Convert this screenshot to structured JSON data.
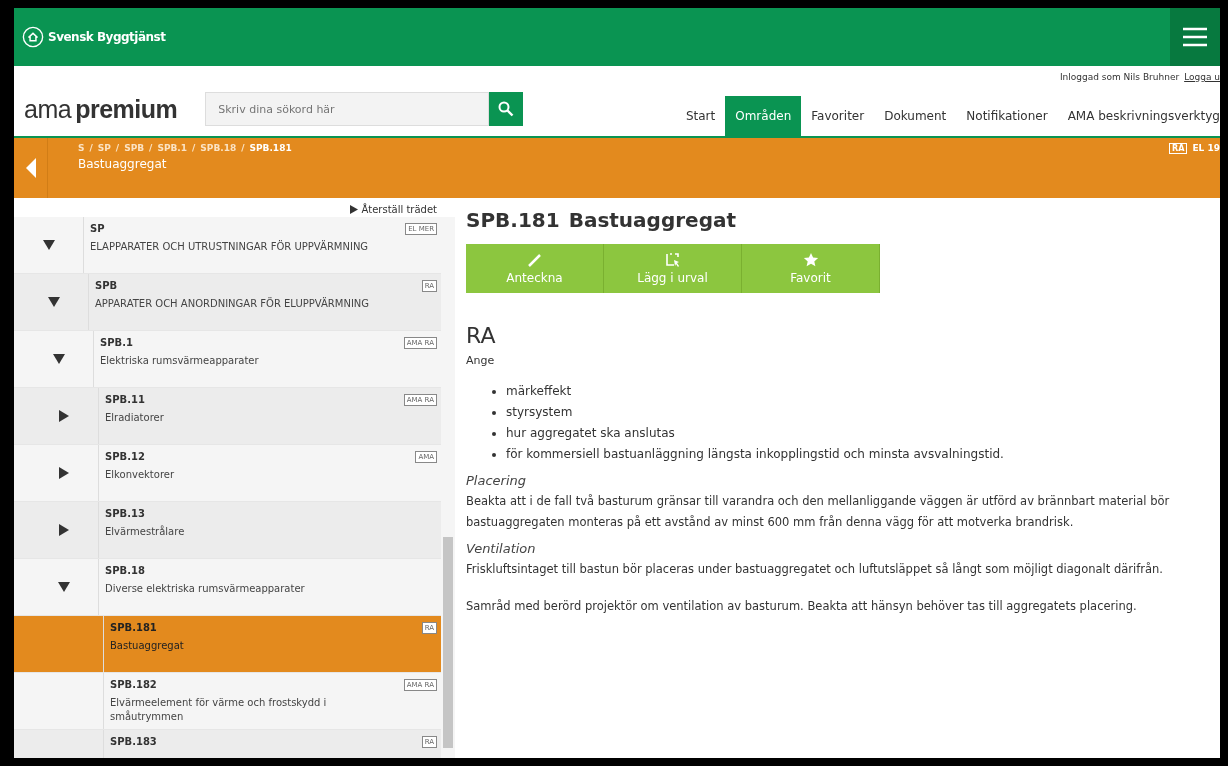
{
  "header": {
    "brand": "Svensk Byggtjänst"
  },
  "user_bar": {
    "logged_in_as": "Inloggad som Nils Bruhner",
    "logout_link": "Logga u"
  },
  "logo": {
    "part_1": "ama",
    "part_2": "premium"
  },
  "search": {
    "placeholder": "Skriv dina sökord här"
  },
  "nav_tabs": [
    {
      "label": "Start",
      "selected": false
    },
    {
      "label": "Områden",
      "selected": true
    },
    {
      "label": "Favoriter",
      "selected": false
    },
    {
      "label": "Dokument",
      "selected": false
    },
    {
      "label": "Notifikationer",
      "selected": false
    },
    {
      "label": "AMA beskrivningsverktyg",
      "selected": false
    }
  ],
  "breadcrumb": {
    "path": [
      "S",
      "SP",
      "SPB",
      "SPB.1",
      "SPB.18",
      "SPB.181"
    ],
    "separator": "/",
    "title": "Bastuaggregat",
    "edition_badge": "RA",
    "edition": "EL 19"
  },
  "tree": {
    "reset_link": "Återställ trädet",
    "items": [
      {
        "code": "SP",
        "title": "ELAPPARATER OCH UTRUSTNINGAR FÖR UPPVÄRMNING",
        "badge": "EL MER",
        "expanded": true,
        "selected": false,
        "children": [
          {
            "code": "SPB",
            "title": "APPARATER OCH ANORDNINGAR FÖR ELUPPVÄRMNING",
            "badge": "RA",
            "expanded": true,
            "selected": false,
            "children": [
              {
                "code": "SPB.1",
                "title": "Elektriska rumsvärmeapparater",
                "badge": "AMA RA",
                "expanded": true,
                "selected": false,
                "children": [
                  {
                    "code": "SPB.11",
                    "title": "Elradiatorer",
                    "badge": "AMA RA",
                    "expanded": false,
                    "selected": false
                  },
                  {
                    "code": "SPB.12",
                    "title": "Elkonvektorer",
                    "badge": "AMA",
                    "expanded": false,
                    "selected": false
                  },
                  {
                    "code": "SPB.13",
                    "title": "Elvärmestrålare",
                    "expanded": false,
                    "selected": false
                  },
                  {
                    "code": "SPB.18",
                    "title": "Diverse elektriska rumsvärmeapparater",
                    "expanded": true,
                    "selected": false,
                    "children": [
                      {
                        "code": "SPB.181",
                        "title": "Bastuaggregat",
                        "badge": "RA",
                        "selected": true
                      },
                      {
                        "code": "SPB.182",
                        "title": "Elvärmeelement för värme och frostskydd i småutrymmen",
                        "badge": "AMA RA",
                        "selected": false
                      },
                      {
                        "code": "SPB.183",
                        "badge": "RA",
                        "selected": false
                      }
                    ]
                  }
                ]
              }
            ]
          }
        ]
      }
    ]
  },
  "article": {
    "code": "SPB.181",
    "title": "Bastuaggregat",
    "actions": [
      "Anteckna",
      "Lägg i urval",
      "Favorit"
    ],
    "section_heading": "RA",
    "intro": "Ange",
    "bullets": [
      "märkeffekt",
      "styrsystem",
      "hur aggregatet ska anslutas",
      "för kommersiell bastuanläggning längsta inkopplingstid och minsta avsvalningstid."
    ],
    "sections": [
      {
        "heading": "Placering",
        "paragraphs": [
          "Beakta att i de fall två basturum gränsar till varandra och den mellanliggande väggen är utförd av brännbart material bör bastuaggregaten monteras på ett avstånd av minst 600 mm från denna vägg för att motverka brandrisk."
        ]
      },
      {
        "heading": "Ventilation",
        "paragraphs": [
          "Friskluftsintaget till bastun bör placeras under bastuaggregatet och luftutsläppet så långt som möjligt diagonalt därifrån.",
          "Samråd med berörd projektör om ventilation av basturum. Beakta att hänsyn behöver tas till aggregatets placering."
        ]
      }
    ]
  }
}
